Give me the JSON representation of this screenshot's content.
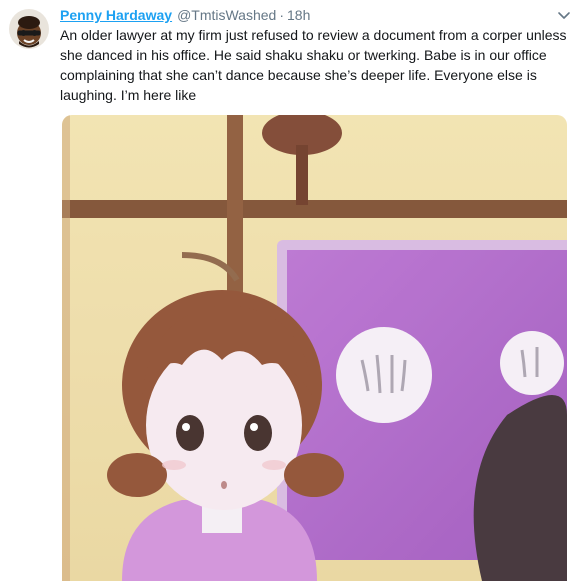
{
  "tweet": {
    "author_name": "Penny Hardaway",
    "handle": "@TmtisWashed",
    "separator": "·",
    "time": "18h",
    "text": "An older lawyer at my firm just refused to review a document from a corper unless she danced in his office. He said shaku shaku or twerking. Babe is in our office complaining that she can’t dance because she’s deeper life. Everyone else is laughing. I’m here like"
  },
  "icons": {
    "avatar": "avatar-emoji",
    "menu": "chevron-down-icon",
    "media": "animated-gif"
  },
  "colors": {
    "name": "#1da1f2",
    "muted": "#657786",
    "text": "#14171a",
    "media_purple": "#b066c8",
    "media_wall": "#ebd9a2"
  }
}
